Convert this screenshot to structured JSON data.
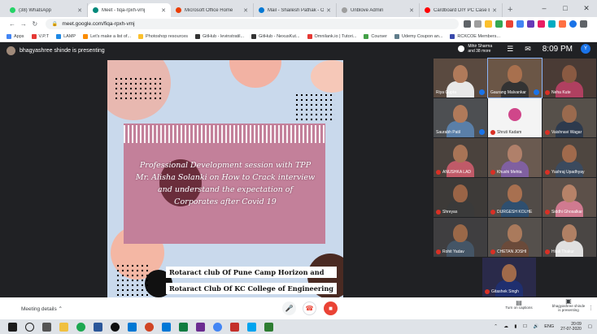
{
  "browser": {
    "tabs": [
      {
        "title": "(38) WhatsApp",
        "color": "#25d366",
        "active": false
      },
      {
        "title": "Meet - fiqa-rpxh-vmj",
        "color": "#00897b",
        "active": true
      },
      {
        "title": "Microsoft Office Home",
        "color": "#eb3c00",
        "active": false
      },
      {
        "title": "Mail - Shailesh Pathak - Outl",
        "color": "#0078d4",
        "active": false
      },
      {
        "title": "Unblove Admin",
        "color": "#9e9e9e",
        "active": false
      },
      {
        "title": "Cardboard DIY PC Case Buil",
        "color": "#ff0000",
        "active": false
      }
    ],
    "url": "meet.google.com/fiqa-rpxh-vmj",
    "bookmarks": [
      {
        "label": "Apps",
        "color": "#4285f4"
      },
      {
        "label": "V.P.T",
        "color": "#e53935"
      },
      {
        "label": "LAMP",
        "color": "#1e88e5"
      },
      {
        "label": "Let's make a list of...",
        "color": "#fb8c00"
      },
      {
        "label": "Photoshop resources",
        "color": "#fbc02d"
      },
      {
        "label": "GitHub - levinstratil...",
        "color": "#333333"
      },
      {
        "label": "GitHub - NexusKut...",
        "color": "#333333"
      },
      {
        "label": "Omnilank.io | Tutori...",
        "color": "#e53935"
      },
      {
        "label": "Courser",
        "color": "#43a047"
      },
      {
        "label": "Udemy Coupon an...",
        "color": "#607d8b"
      },
      {
        "label": "RCKCOE Members...",
        "color": "#3949ab"
      }
    ]
  },
  "meet": {
    "presenter_text": "bhagyashree shinde is presenting",
    "people_label_line1": "Mihir Sharma",
    "people_label_line2": "and 38 more",
    "time": "8:09 PM",
    "you_label": "You"
  },
  "slide": {
    "caption": "Professional Development session with TPP Mr. Alisha Solanki on How to Crack interview and understand the expectation of Corporates after Covid 19",
    "club_line_1": "Rotaract club Of Pune Camp Horizon and",
    "club_line_2": "Rotaract Club Of KC College of Engineering"
  },
  "participants": [
    {
      "name": "Riya Gupta",
      "face": "#b07a5a",
      "body": "#e8e8e8",
      "bg": "#5a4a40",
      "muted": false
    },
    {
      "name": "Gaurang Malvankar",
      "face": "#a8704e",
      "body": "#333333",
      "bg": "#6b5646",
      "muted": false,
      "highlight": true
    },
    {
      "name": "Neha Kute",
      "face": "#8a5a42",
      "body": "#b04060",
      "bg": "#4a3b35",
      "muted": true
    },
    {
      "name": "Saurabh Patil",
      "face": "#b07a5a",
      "body": "#5a7fa8",
      "bg": "#4d4f52",
      "muted": false
    },
    {
      "name": "Shruti Kadam",
      "face": "#f6f6f6",
      "body": "#d0468a",
      "bg": "#f4f4f4",
      "muted": true,
      "avatar": true
    },
    {
      "name": "Vaishnavi Wagar",
      "face": "#9a6a4e",
      "body": "#2d3a4d",
      "bg": "#56504a",
      "muted": true
    },
    {
      "name": "ANUSHKA LAD",
      "face": "#a87456",
      "body": "#c05a68",
      "bg": "#4a423d",
      "muted": true
    },
    {
      "name": "Khushi Mehta",
      "face": "#b0806a",
      "body": "#8060a0",
      "bg": "#6a5a50",
      "muted": true
    },
    {
      "name": "Yashraj Upadhyay",
      "face": "#a06a4c",
      "body": "#3b4a5e",
      "bg": "#4e4640",
      "muted": true
    },
    {
      "name": "Shreyas",
      "face": "#9a6446",
      "body": "#3a3a3a",
      "bg": "#3d3a38",
      "muted": true
    },
    {
      "name": "DURGESH KOLHE",
      "face": "#a87050",
      "body": "#2f4f6f",
      "bg": "#514b47",
      "muted": true
    },
    {
      "name": "Siddhi Ghosalkar",
      "face": "#b68268",
      "body": "#d07a90",
      "bg": "#5c5049",
      "muted": true
    },
    {
      "name": "Rohit Yadav",
      "face": "#9a6848",
      "body": "#445566",
      "bg": "#3f3e40",
      "muted": true
    },
    {
      "name": "CHETAN JOSHI",
      "face": "#aa7a5c",
      "body": "#6a4a3a",
      "bg": "#55504c",
      "muted": true
    },
    {
      "name": "Hitali Thakur",
      "face": "#b08064",
      "body": "#e0e0e0",
      "bg": "#4a4644",
      "muted": true
    },
    {
      "name": "Gitashek Singh",
      "face": "#a06a4a",
      "body": "#1f2f6f",
      "bg": "#2a2a4a",
      "muted": true
    }
  ],
  "bottom": {
    "meeting_details": "Meeting details",
    "captions_label": "Turn on captions",
    "present_line1": "bhagyashree shinde",
    "present_line2": "is presenting"
  },
  "taskbar": {
    "lang": "ENG",
    "clock_line1": "20:09",
    "clock_line2": "27-07-2020"
  },
  "colors": {
    "meet_bg": "#202124",
    "slide_bg": "#c9d9ec",
    "panel": "#c3809a",
    "hangup": "#ea4335",
    "accent": "#1a73e8"
  }
}
